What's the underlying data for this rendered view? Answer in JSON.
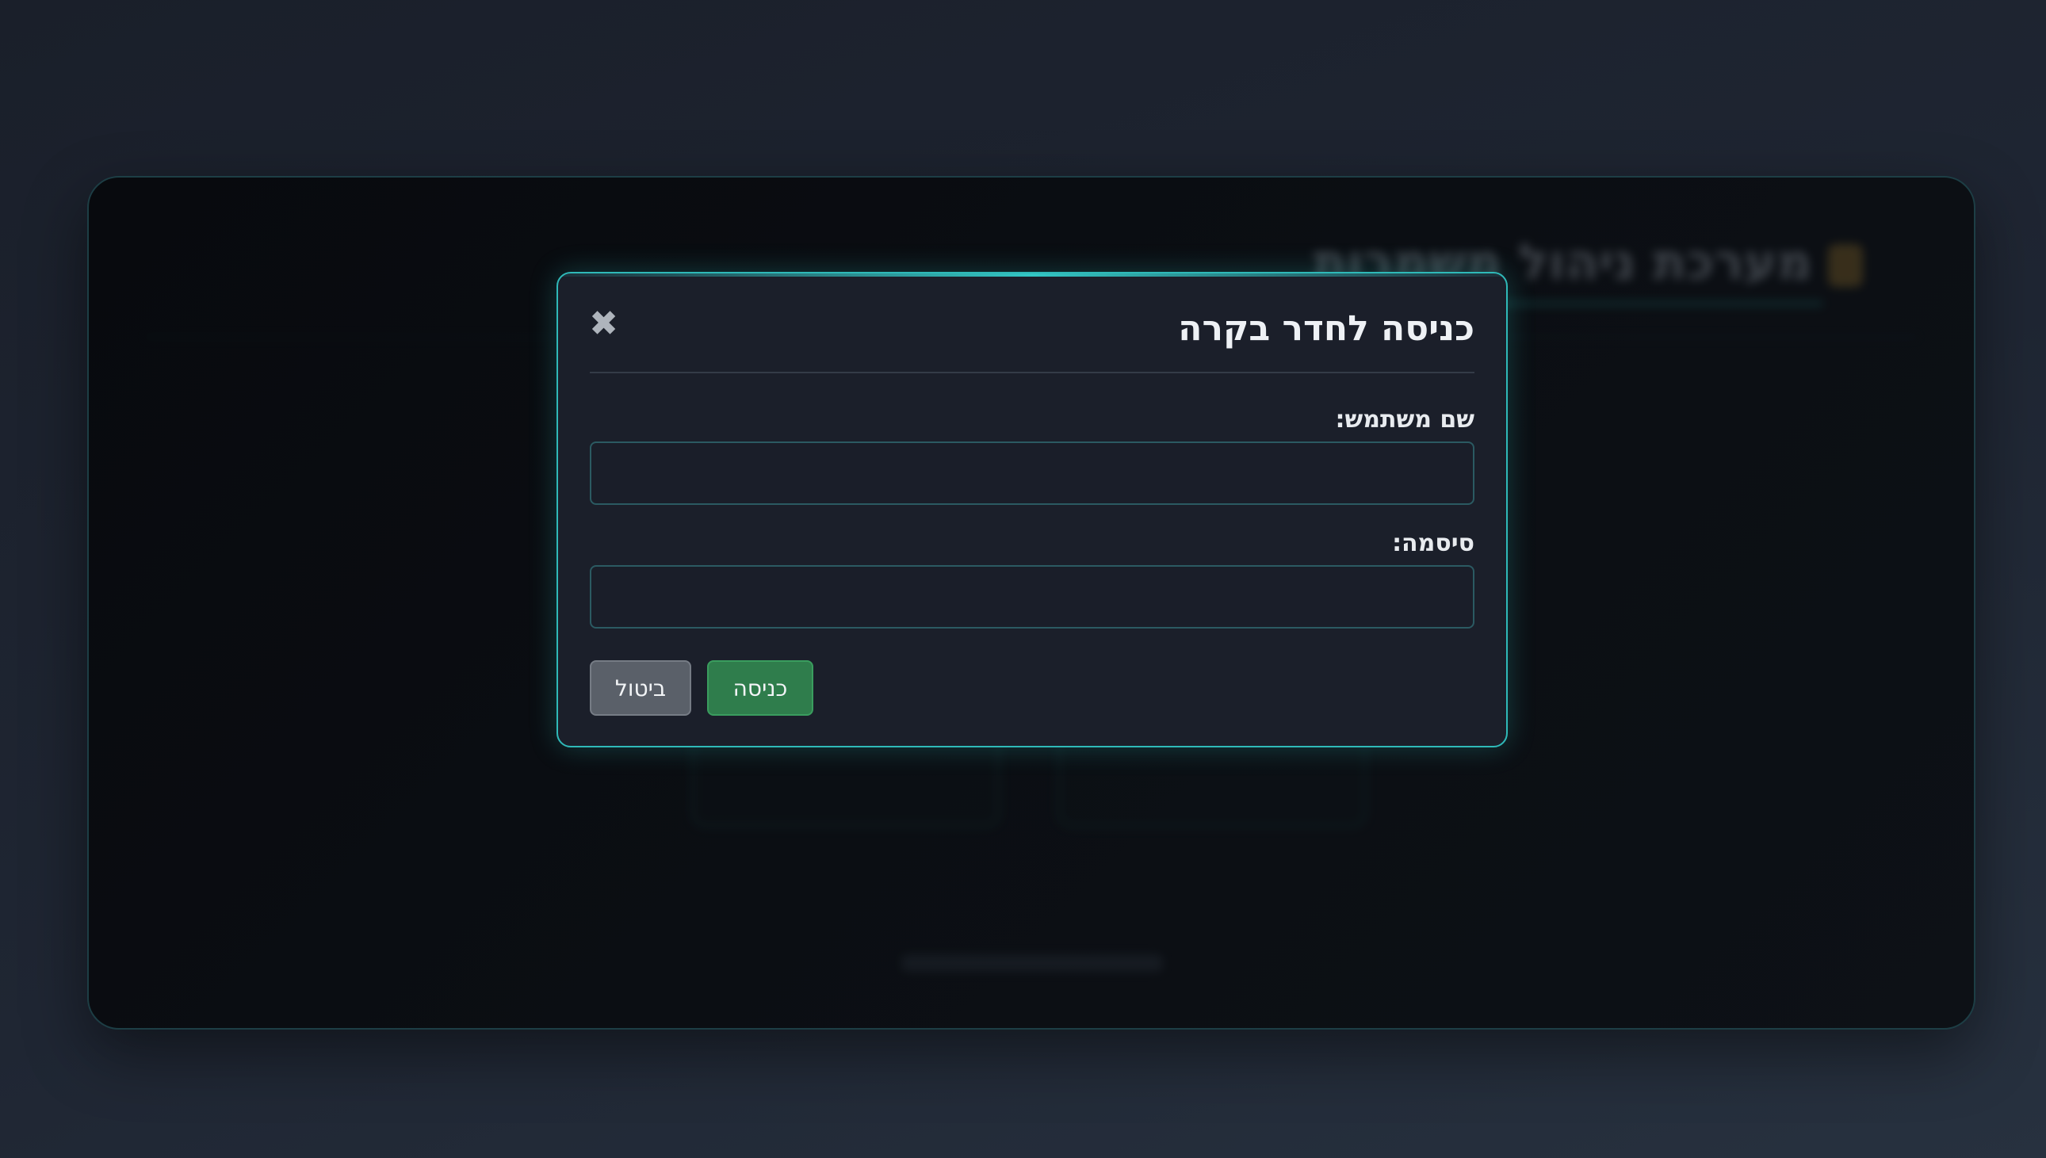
{
  "background": {
    "app_title": "מערכת ניהול משמרות"
  },
  "modal": {
    "title": "כניסה לחדר בקרה",
    "close_glyph": "✖",
    "username_label": "שם משתמש:",
    "username_value": "",
    "password_label": "סיסמה:",
    "password_value": "",
    "enter_button": "כניסה",
    "cancel_button": "ביטול"
  },
  "colors": {
    "accent": "#2fb9b8",
    "enter_button": "#2f7d4c",
    "cancel_button": "#5a6069",
    "modal_background": "#1b1f2a"
  }
}
